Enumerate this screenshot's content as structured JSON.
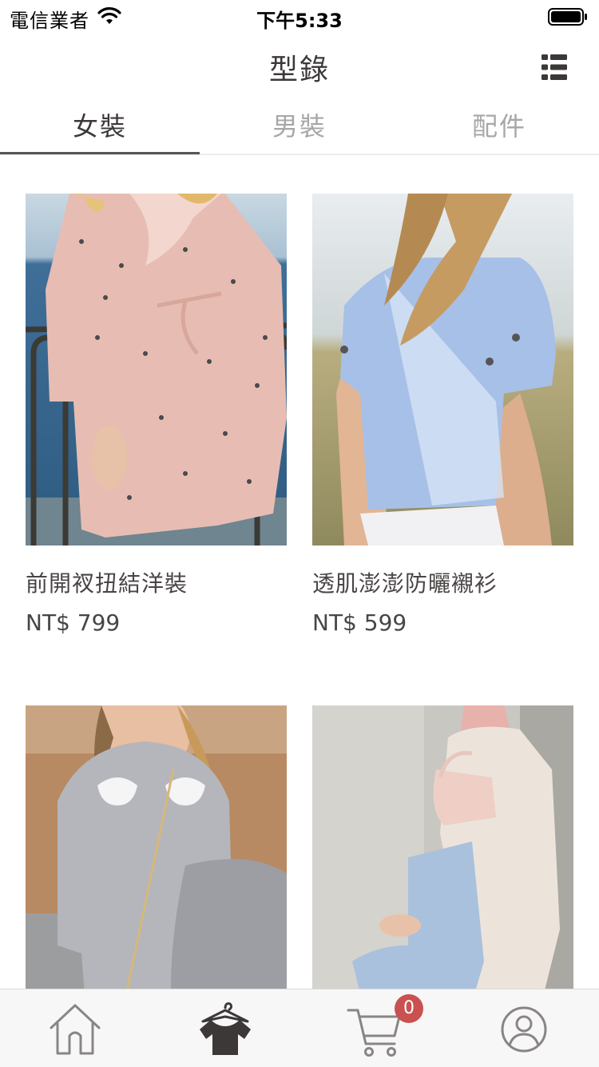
{
  "status_bar": {
    "carrier": "電信業者",
    "time": "下午5:33"
  },
  "nav": {
    "title": "型錄"
  },
  "tabs": [
    {
      "label": "女裝",
      "active": true
    },
    {
      "label": "男裝",
      "active": false
    },
    {
      "label": "配件",
      "active": false
    }
  ],
  "products": [
    {
      "name": "前開衩扭結洋裝",
      "price": "NT$ 799",
      "image": "pink bird-print wrap dress by the sea"
    },
    {
      "name": "透肌澎澎防曬襯衫",
      "price": "NT$ 599",
      "image": "light blue blouse, long hair in the wind"
    },
    {
      "name": "",
      "price": "",
      "image": "grey sheer blouse with shell appliqués"
    },
    {
      "name": "",
      "price": "",
      "image": "beige coat, jeans, pink bag by a wall"
    }
  ],
  "bottom_bar": {
    "items": [
      {
        "icon": "home-icon",
        "active": false
      },
      {
        "icon": "catalog-shirt-icon",
        "active": true
      },
      {
        "icon": "cart-icon",
        "active": false
      },
      {
        "icon": "profile-icon",
        "active": false
      }
    ],
    "cart_count": "0"
  },
  "colors": {
    "active_text": "#3d3838",
    "inactive_text": "#a9a6a6",
    "badge": "#c9514f",
    "tab_bar_bg": "#f7f7f7"
  }
}
